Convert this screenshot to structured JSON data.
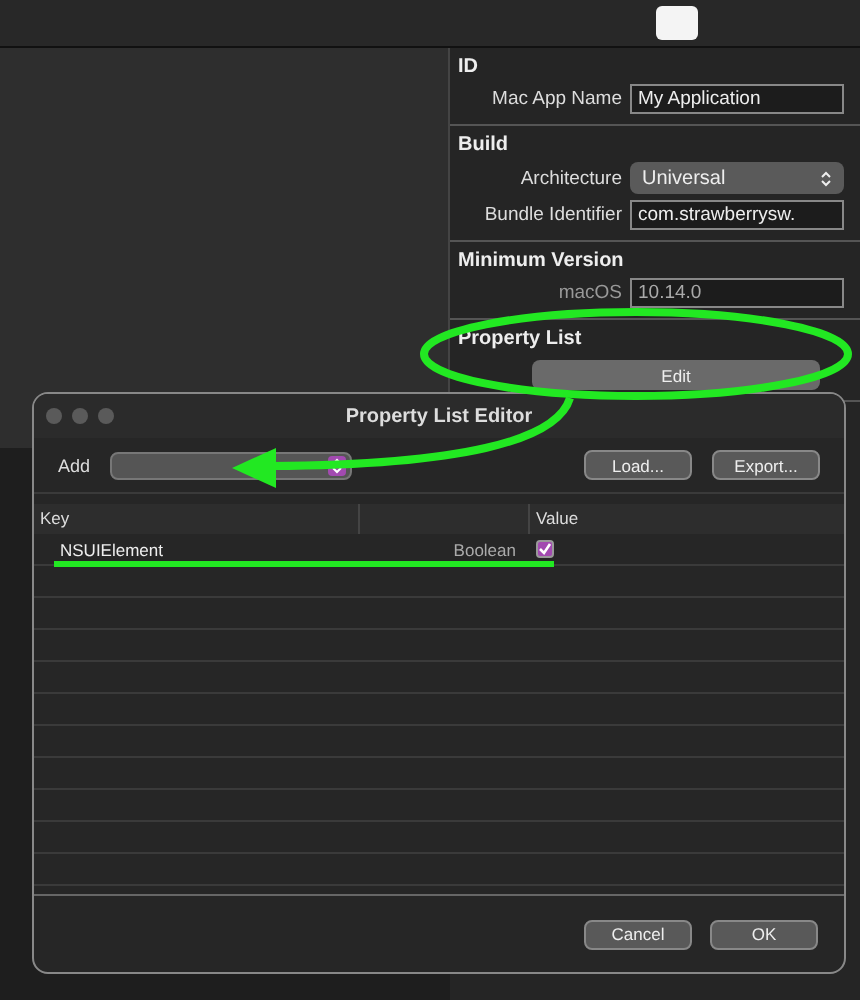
{
  "inspector": {
    "sections": [
      {
        "title": "ID",
        "rows": [
          {
            "kind": "text",
            "label": "Mac App Name",
            "value": "My Application",
            "disabled": false
          }
        ]
      },
      {
        "title": "Build",
        "rows": [
          {
            "kind": "popup",
            "label": "Architecture",
            "value": "Universal",
            "disabled": false
          },
          {
            "kind": "text",
            "label": "Bundle Identifier",
            "value": "com.strawberrysw.",
            "disabled": false
          }
        ]
      },
      {
        "title": "Minimum Version",
        "rows": [
          {
            "kind": "text",
            "label": "macOS",
            "value": "10.14.0",
            "disabled": true
          }
        ]
      },
      {
        "title": "Property List",
        "rows": [
          {
            "kind": "button",
            "value": "Edit",
            "disabled": false
          }
        ]
      }
    ]
  },
  "dialog": {
    "title": "Property List Editor",
    "add_label": "Add",
    "toolbar_buttons": [
      "Load...",
      "Export..."
    ],
    "columns": [
      "Key",
      "Value"
    ],
    "rows": [
      {
        "key": "NSUIElement",
        "type": "Boolean",
        "checked": true
      }
    ],
    "footer_buttons": [
      "Cancel",
      "OK"
    ]
  }
}
